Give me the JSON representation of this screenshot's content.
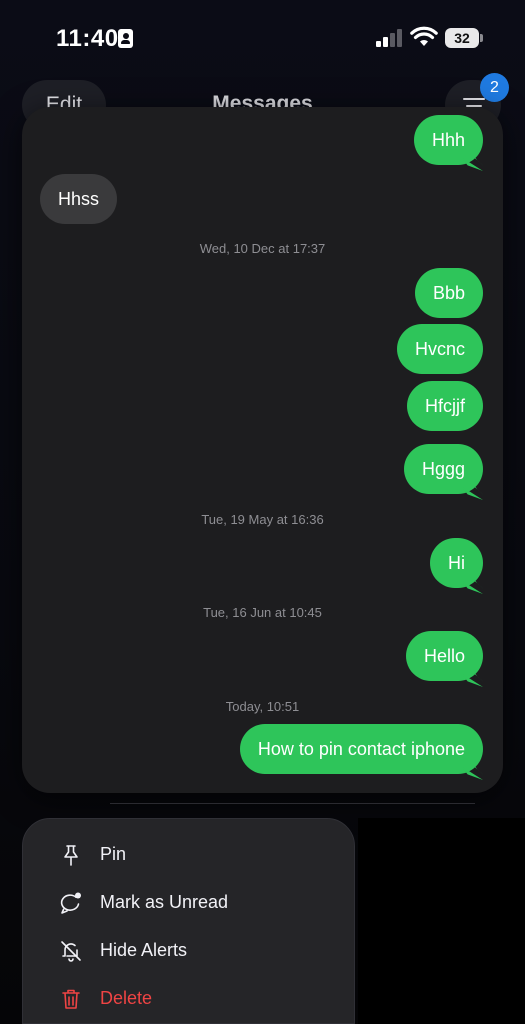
{
  "status_bar": {
    "time": "11:40",
    "battery": "32"
  },
  "nav": {
    "edit_label": "Edit",
    "title": "Messages",
    "badge_count": "2"
  },
  "conversation": {
    "items": [
      {
        "kind": "bubble",
        "dir": "out",
        "text": "Hhh"
      },
      {
        "kind": "bubble",
        "dir": "in",
        "text": "Hhss"
      },
      {
        "kind": "timestamp",
        "day": "Wed, 10 Dec",
        "time": "17:37",
        "text": "Wed, 10 Dec at 17:37"
      },
      {
        "kind": "bubble",
        "dir": "out",
        "text": "Bbb"
      },
      {
        "kind": "bubble",
        "dir": "out",
        "text": "Hvcnc"
      },
      {
        "kind": "bubble",
        "dir": "out",
        "text": "Hfcjjf"
      },
      {
        "kind": "bubble",
        "dir": "out",
        "text": "Hggg"
      },
      {
        "kind": "timestamp",
        "text": "Tue, 19 May at 16:36"
      },
      {
        "kind": "bubble",
        "dir": "out",
        "text": "Hi"
      },
      {
        "kind": "timestamp",
        "text": "Tue, 16 Jun at 10:45"
      },
      {
        "kind": "bubble",
        "dir": "out",
        "text": "Hello"
      },
      {
        "kind": "timestamp",
        "text": "Today, 10:51"
      },
      {
        "kind": "bubble",
        "dir": "out",
        "text": "How to pin contact iphone"
      }
    ]
  },
  "context_menu": {
    "items": [
      {
        "label": "Pin",
        "icon": "pin-icon"
      },
      {
        "label": "Mark as Unread",
        "icon": "unread-bubble-icon"
      },
      {
        "label": "Hide Alerts",
        "icon": "bell-slash-icon"
      },
      {
        "label": "Delete",
        "icon": "trash-icon",
        "color": "#ef4444"
      }
    ]
  },
  "colors": {
    "outgoing_bubble": "#2ec55a",
    "incoming_bubble": "#3a3a3c",
    "badge": "#1f7ae0",
    "destructive": "#ef4444"
  }
}
